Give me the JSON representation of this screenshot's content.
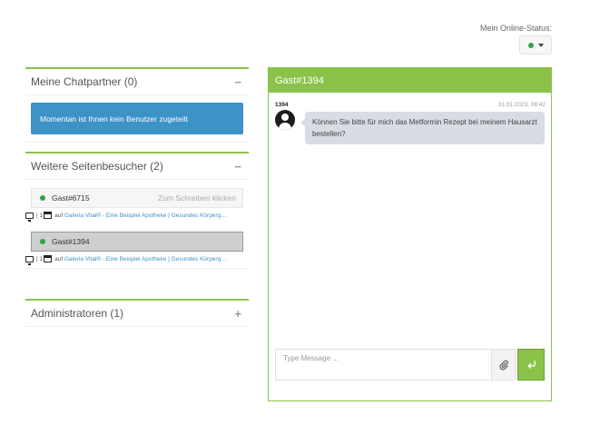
{
  "online_status": {
    "label": "Mein Online-Status:",
    "indicator_color": "#2ea44f"
  },
  "panels": {
    "chat_partners": {
      "title": "Meine Chatpartner (0)",
      "toggle": "−",
      "info": "Momentan ist Ihnen kein Benutzer zugeteilt"
    },
    "visitors": {
      "title": "Weitere Seitenbesucher (2)",
      "toggle": "−",
      "items": [
        {
          "name": "Gast#6715",
          "hint": "Zum Schreiben klicken",
          "tab_count": "1",
          "separator": "|",
          "on_label": "auf",
          "page": "Galeria Vital® - Eine Beispiel Apotheke | Gesundes Körpergefühl"
        },
        {
          "name": "Gast#1394",
          "hint": "",
          "tab_count": "1",
          "separator": "|",
          "on_label": "auf",
          "page": "Galeria Vital® - Eine Beispiel Apotheke | Gesundes Körpergefühl"
        }
      ]
    },
    "admins": {
      "title": "Administratoren (1)",
      "toggle": "+"
    }
  },
  "chat": {
    "title": "Gast#1394",
    "messages": [
      {
        "user": "1394",
        "time": "31.01.2023, 08:42",
        "text": "Können Sie bitte für mich das Metformin Rezept bei meinem Hausarzt bestellen?"
      }
    ],
    "input_placeholder": "Type Message ...",
    "attach_icon": "paperclip-icon",
    "send_icon": "enter-icon"
  },
  "colors": {
    "accent": "#8bc34a",
    "info": "#3d92c6"
  }
}
